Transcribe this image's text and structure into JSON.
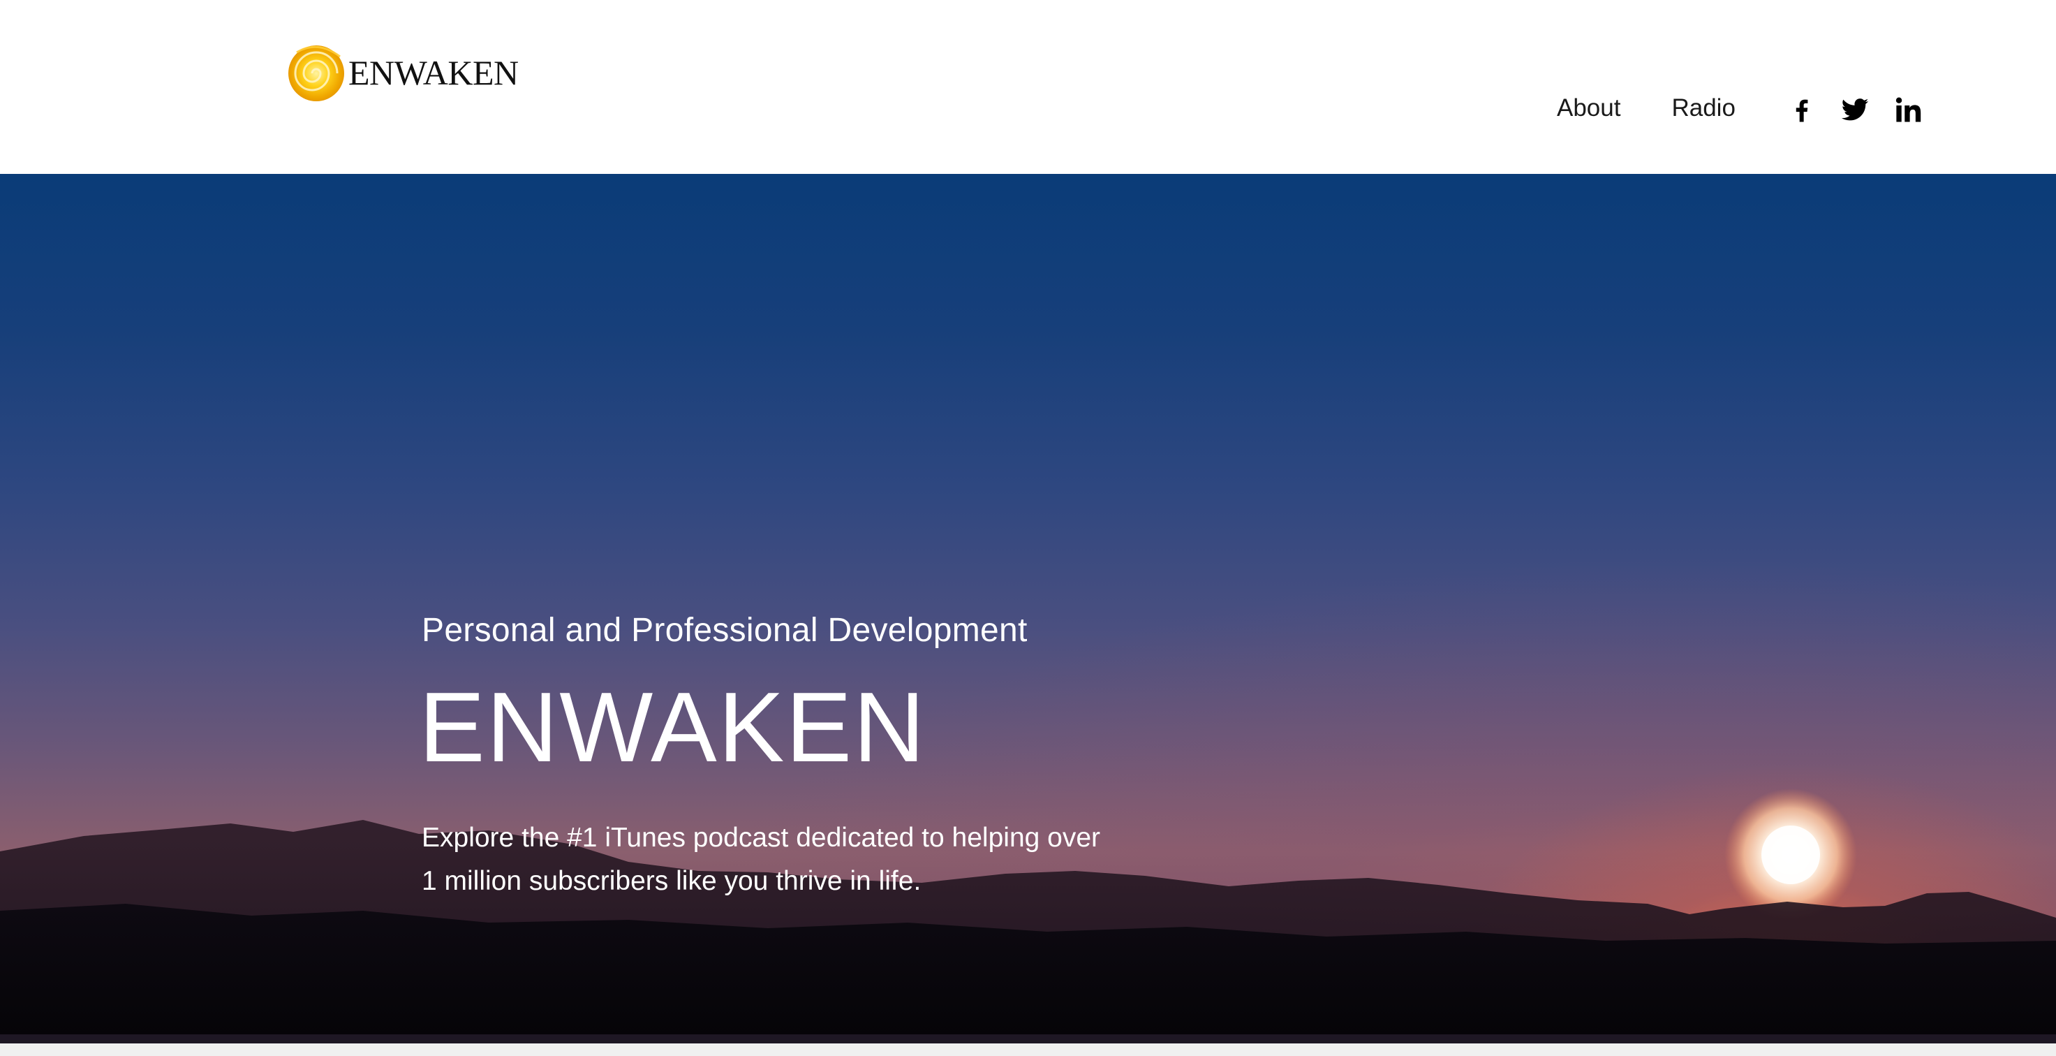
{
  "header": {
    "logo_text": "ENWAKEN",
    "nav": [
      {
        "label": "About"
      },
      {
        "label": "Radio"
      }
    ],
    "socials": [
      {
        "icon": "facebook-icon"
      },
      {
        "icon": "twitter-icon"
      },
      {
        "icon": "linkedin-icon"
      }
    ]
  },
  "hero": {
    "subtitle": "Personal and Professional Development",
    "title": "ENWAKEN",
    "description": "Explore the #1 iTunes podcast dedicated to helping over 1 million subscribers like you thrive in life."
  },
  "colors": {
    "logo_sun": "#f5b800",
    "sky_top": "#0a3c78",
    "sunset": "#f08a5a",
    "text_light": "#ffffff",
    "nav_text": "#1a1a1a"
  }
}
